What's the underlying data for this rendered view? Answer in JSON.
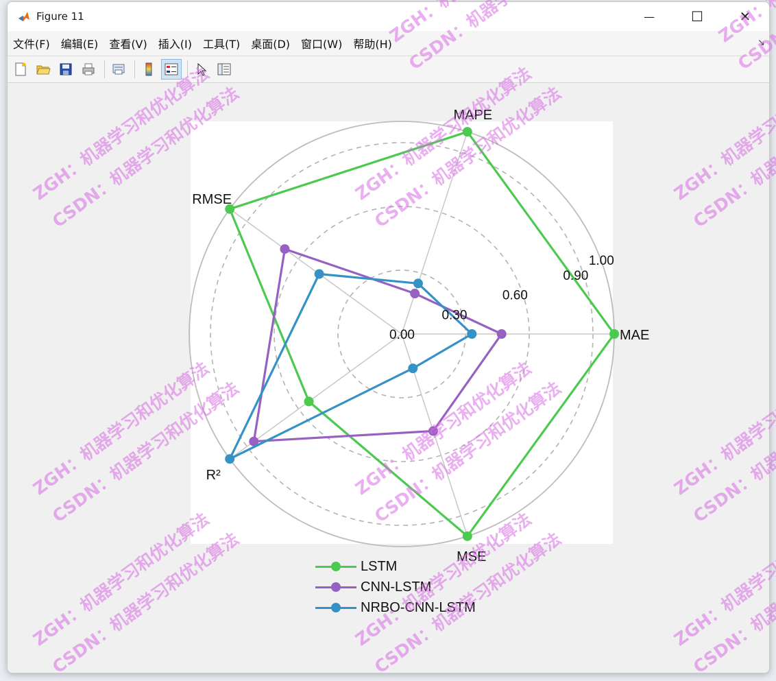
{
  "window": {
    "title": "Figure 11",
    "minimize_glyph": "—",
    "maximize_glyph": "☐",
    "close_glyph": "✕"
  },
  "menu": {
    "items": [
      "文件(F)",
      "编辑(E)",
      "查看(V)",
      "插入(I)",
      "工具(T)",
      "桌面(D)",
      "窗口(W)",
      "帮助(H)"
    ],
    "dock_arrow": "↘"
  },
  "toolbar": {
    "buttons": [
      "new-figure-icon",
      "open-folder-icon",
      "save-icon",
      "print-icon",
      "print-preview-icon",
      "colorbar-icon",
      "legend-icon",
      "pointer-icon",
      "property-editor-icon"
    ]
  },
  "chart_data": {
    "type": "radar",
    "axes": [
      "MAE",
      "MAPE",
      "RMSE",
      "R²",
      "MSE"
    ],
    "rlim": [
      0,
      1.0
    ],
    "tick_values": [
      0.0,
      0.3,
      0.6,
      0.9,
      1.0
    ],
    "tick_labels": [
      "0.00",
      "0.30",
      "0.60",
      "0.90",
      "1.00"
    ],
    "grid": true,
    "legend_position": "bottom",
    "series": [
      {
        "name": "LSTM",
        "color": "#4cc94f",
        "values": [
          1.0,
          1.0,
          1.0,
          0.54,
          1.0
        ]
      },
      {
        "name": "CNN-LSTM",
        "color": "#9661c2",
        "values": [
          0.47,
          0.2,
          0.68,
          0.86,
          0.48
        ]
      },
      {
        "name": "NRBO-CNN-LSTM",
        "color": "#3592c6",
        "values": [
          0.33,
          0.25,
          0.48,
          1.0,
          0.17
        ]
      }
    ]
  },
  "watermark": {
    "line1": "ZGH：机器学习和优化算法",
    "line2": "CSDN：机器学习和优化算法"
  }
}
